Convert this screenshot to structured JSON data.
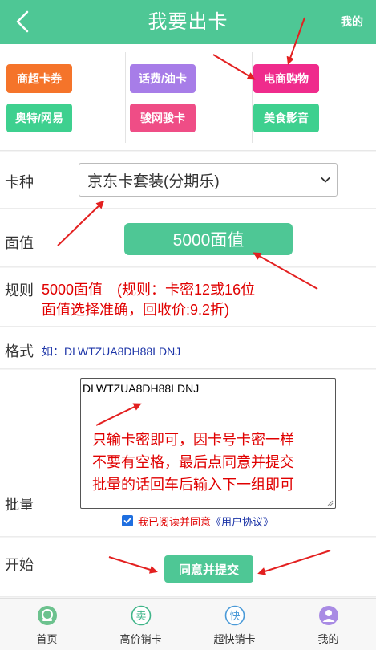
{
  "header": {
    "title": "我要出卡",
    "mine_label": "我的"
  },
  "categories": [
    {
      "label": "商超卡券",
      "color": "#f5742a"
    },
    {
      "label": "话费/油卡",
      "color": "#a77de8"
    },
    {
      "label": "电商购物",
      "color": "#ef2b8c"
    },
    {
      "label": "奥特/网易",
      "color": "#3ed08f"
    },
    {
      "label": "骏网骏卡",
      "color": "#ef4d86"
    },
    {
      "label": "美食影音",
      "color": "#3ed08f"
    }
  ],
  "form": {
    "card_type": {
      "label": "卡种",
      "selected": "京东卡套装(分期乐)"
    },
    "denomination": {
      "label": "面值",
      "value": "5000面值"
    },
    "rules": {
      "label": "规则",
      "line1": "5000面值　(规则：卡密12或16位",
      "line2": "面值选择准确，回收价:9.2折)"
    },
    "format": {
      "label": "格式",
      "example": "如：DLWTZUA8DH88LDNJ"
    },
    "batch": {
      "label": "批量",
      "value": "DLWTZUA8DH88LDNJ",
      "note_line1": "只输卡密即可，因卡号卡密一样",
      "note_line2": "不要有空格，最后点同意并提交",
      "note_line3": "批量的话回车后输入下一组即可"
    },
    "agreement": {
      "prefix": "我已阅读并同意",
      "link": "《用户协议》",
      "checked": true
    },
    "start": {
      "label": "开始",
      "submit_label": "同意并提交"
    }
  },
  "tabbar": [
    {
      "label": "首页",
      "icon": "home-icon"
    },
    {
      "label": "高价销卡",
      "icon": "sell-icon"
    },
    {
      "label": "超快销卡",
      "icon": "fast-icon"
    },
    {
      "label": "我的",
      "icon": "user-icon"
    }
  ],
  "colors": {
    "accent": "#4ec795",
    "warning_text": "#e00000",
    "link_text": "#1d35a8",
    "annotation_arrow": "#e32020"
  }
}
